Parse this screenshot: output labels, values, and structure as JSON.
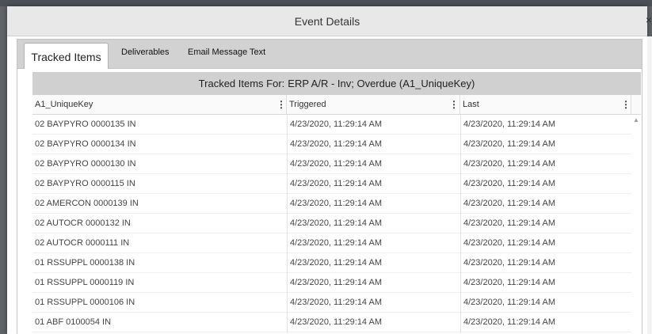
{
  "dialog": {
    "title": "Event Details",
    "close_glyph": "×"
  },
  "tabs": [
    {
      "label": "Tracked Items",
      "active": true
    },
    {
      "label": "Deliverables",
      "active": false
    },
    {
      "label": "Email Message Text",
      "active": false
    }
  ],
  "grid": {
    "title_prefix": "Tracked Items For:",
    "title_subject": "ERP A/R - Inv; Overdue (A1_UniqueKey)",
    "menu_glyph": "⋮",
    "scroll_up_glyph": "▲",
    "columns": [
      {
        "label": "A1_UniqueKey"
      },
      {
        "label": "Triggered"
      },
      {
        "label": "Last"
      }
    ],
    "rows": [
      [
        "02 BAYPYRO 0000135 IN",
        "4/23/2020, 11:29:14 AM",
        "4/23/2020, 11:29:14 AM"
      ],
      [
        "02 BAYPYRO 0000134 IN",
        "4/23/2020, 11:29:14 AM",
        "4/23/2020, 11:29:14 AM"
      ],
      [
        "02 BAYPYRO 0000130 IN",
        "4/23/2020, 11:29:14 AM",
        "4/23/2020, 11:29:14 AM"
      ],
      [
        "02 BAYPYRO 0000115 IN",
        "4/23/2020, 11:29:14 AM",
        "4/23/2020, 11:29:14 AM"
      ],
      [
        "02 AMERCON 0000139 IN",
        "4/23/2020, 11:29:14 AM",
        "4/23/2020, 11:29:14 AM"
      ],
      [
        "02 AUTOCR 0000132 IN",
        "4/23/2020, 11:29:14 AM",
        "4/23/2020, 11:29:14 AM"
      ],
      [
        "02 AUTOCR 0000111 IN",
        "4/23/2020, 11:29:14 AM",
        "4/23/2020, 11:29:14 AM"
      ],
      [
        "01 RSSUPPL 0000138 IN",
        "4/23/2020, 11:29:14 AM",
        "4/23/2020, 11:29:14 AM"
      ],
      [
        "01 RSSUPPL 0000119 IN",
        "4/23/2020, 11:29:14 AM",
        "4/23/2020, 11:29:14 AM"
      ],
      [
        "01 RSSUPPL 0000106 IN",
        "4/23/2020, 11:29:14 AM",
        "4/23/2020, 11:29:14 AM"
      ],
      [
        "01 ABF 0100054 IN",
        "4/23/2020, 11:29:14 AM",
        "4/23/2020, 11:29:14 AM"
      ]
    ]
  }
}
